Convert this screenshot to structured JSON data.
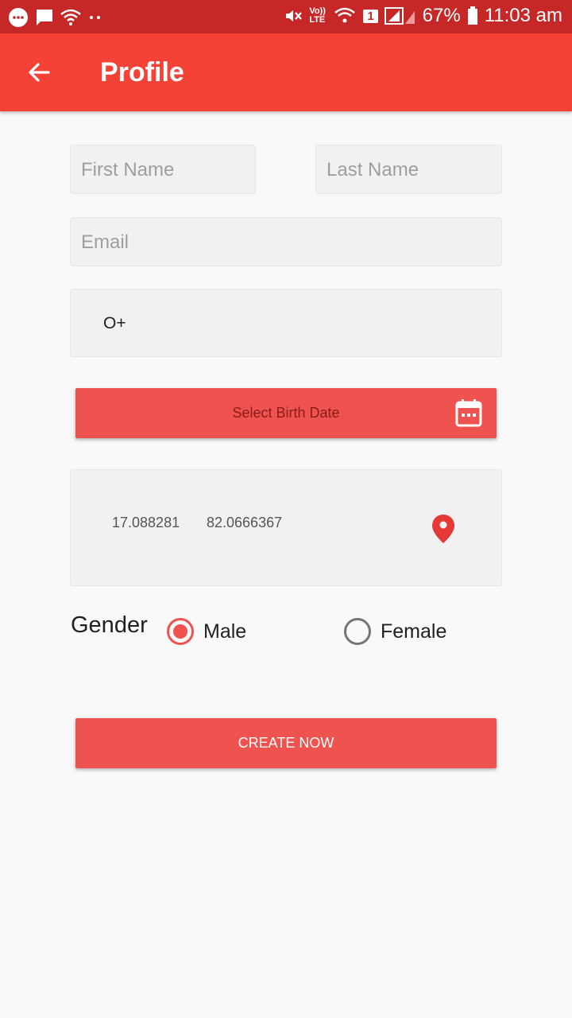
{
  "status_bar": {
    "battery_percent": "67%",
    "time": "11:03 am",
    "volte_label": "Vo)) LTE",
    "sim_badge": "1"
  },
  "app_bar": {
    "title": "Profile"
  },
  "form": {
    "first_name_placeholder": "First Name",
    "last_name_placeholder": "Last Name",
    "email_placeholder": "Email",
    "blood_group_value": "O+",
    "birth_date_label": "Select Birth Date",
    "latitude": "17.088281",
    "longitude": "82.0666367",
    "gender_label": "Gender",
    "gender_options": [
      "Male",
      "Female"
    ],
    "gender_selected": "Male",
    "submit_label": "CREATE NOW"
  },
  "colors": {
    "status_bar": "#c62828",
    "app_bar": "#f44336",
    "accent": "#ef5350"
  }
}
